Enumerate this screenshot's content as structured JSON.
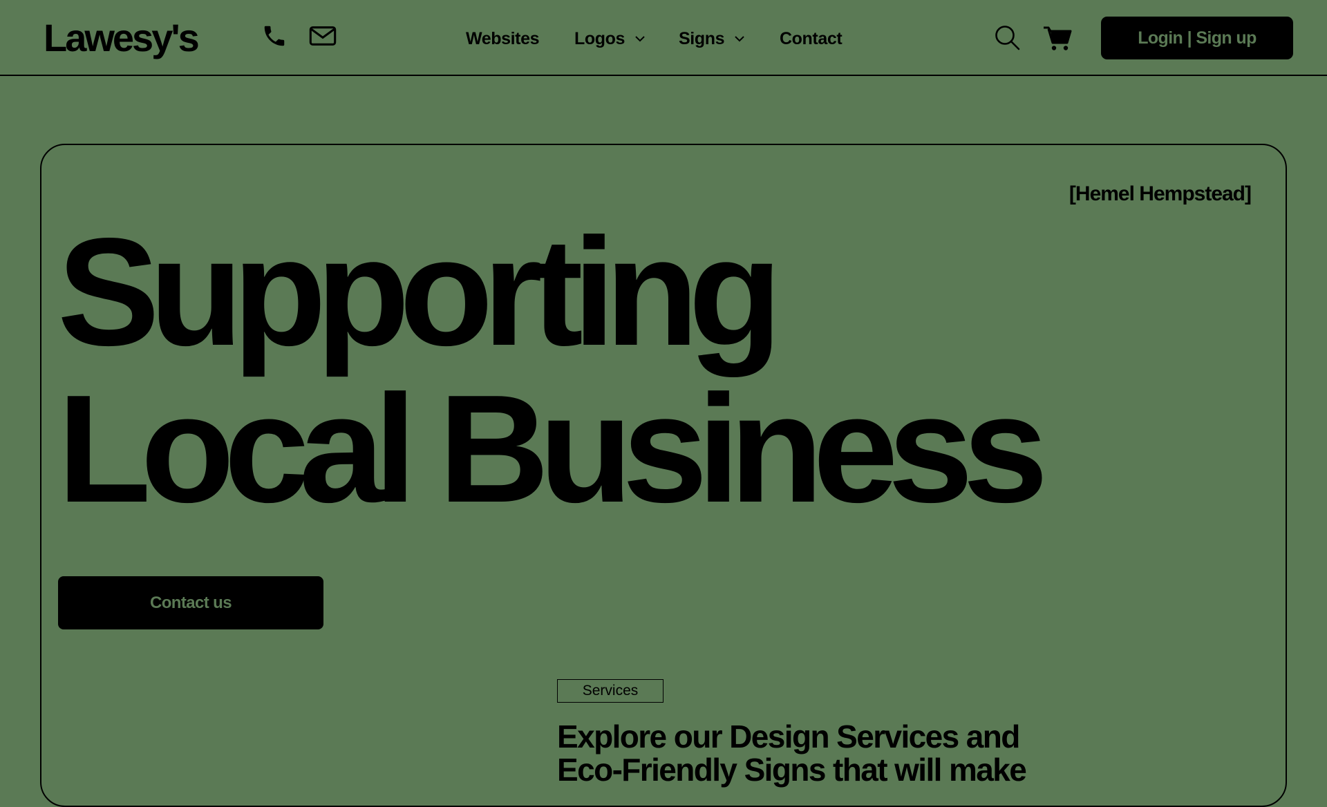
{
  "header": {
    "logo": "Lawesy's",
    "contact_icons": [
      "phone-icon",
      "envelope-icon"
    ],
    "nav": [
      {
        "label": "Websites",
        "has_dropdown": false
      },
      {
        "label": "Logos",
        "has_dropdown": true
      },
      {
        "label": "Signs",
        "has_dropdown": true
      },
      {
        "label": "Contact",
        "has_dropdown": false
      }
    ],
    "action_icons": [
      "search-icon",
      "cart-icon"
    ],
    "login_label": "Login | Sign up"
  },
  "hero": {
    "location": "[Hemel Hempstead]",
    "headline_line1": "Supporting",
    "headline_line2": "Local Business",
    "cta_label": "Contact us"
  },
  "services": {
    "tag": "Services",
    "heading": "Explore our Design Services and Eco-Friendly Signs that will make"
  },
  "colors": {
    "background": "#5b7a55",
    "ink": "#000000"
  }
}
